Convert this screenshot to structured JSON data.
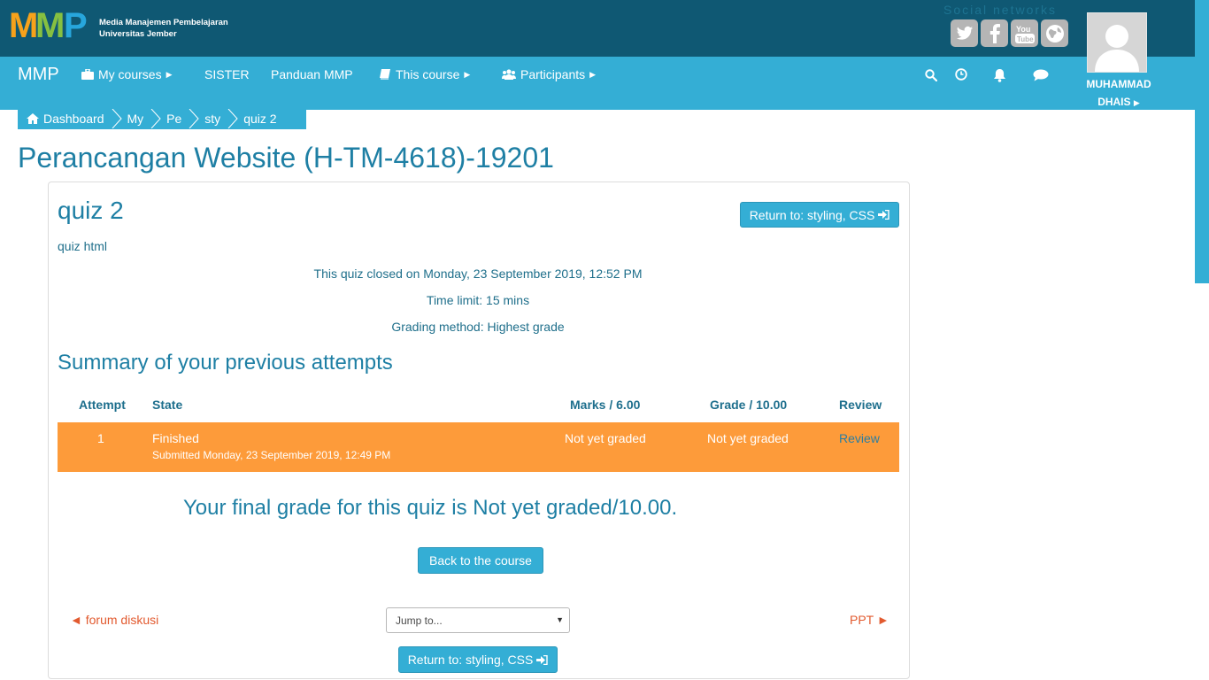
{
  "brand": {
    "logo_text": "MMP",
    "line1": "Media Manajemen Pembelajaran",
    "line2": "Universitas Jember"
  },
  "social": {
    "label": "Social networks",
    "icons": [
      "twitter-icon",
      "facebook-icon",
      "youtube-icon",
      "globe-icon"
    ]
  },
  "nav": {
    "brand": "MMP",
    "items": [
      {
        "label": "My courses",
        "icon": "briefcase-icon"
      },
      {
        "label": "SISTER"
      },
      {
        "label": "Panduan MMP"
      },
      {
        "label": "This course",
        "icon": "book-icon"
      },
      {
        "label": "Participants",
        "icon": "users-icon"
      }
    ],
    "right_icons": [
      "search-icon",
      "clock-icon",
      "bell-icon",
      "chat-icon"
    ]
  },
  "user": {
    "first": "MUHAMMAD",
    "last": "DHAIS"
  },
  "breadcrumb": [
    "Dashboard",
    "My",
    "Pe",
    "sty",
    "quiz 2"
  ],
  "course_title": "Perancangan Website (H-TM-4618)-19201",
  "quiz": {
    "title": "quiz 2",
    "return_label": "Return to: styling, CSS",
    "intro": "quiz html",
    "closed": "This quiz closed on Monday, 23 September 2019, 12:52 PM",
    "time_limit": "Time limit: 15 mins",
    "grading": "Grading method: Highest grade"
  },
  "summary": {
    "title": "Summary of your previous attempts",
    "headers": {
      "attempt": "Attempt",
      "state": "State",
      "marks": "Marks / 6.00",
      "grade": "Grade / 10.00",
      "review": "Review"
    },
    "rows": [
      {
        "attempt": "1",
        "state": "Finished",
        "submitted": "Submitted Monday, 23 September 2019, 12:49 PM",
        "marks": "Not yet graded",
        "grade": "Not yet graded",
        "review": "Review"
      }
    ]
  },
  "final_grade": "Your final grade for this quiz is Not yet graded/10.00.",
  "back_button": "Back to the course",
  "activity_nav": {
    "prev": "◄ forum diskusi",
    "jump_placeholder": "Jump to...",
    "next": "PPT ►"
  },
  "colors": {
    "topbar": "#0f5873",
    "navbar": "#34aed5",
    "title": "#1e7fa4",
    "attempt_row": "#fd9b3a",
    "link_accent": "#e25a2f"
  }
}
